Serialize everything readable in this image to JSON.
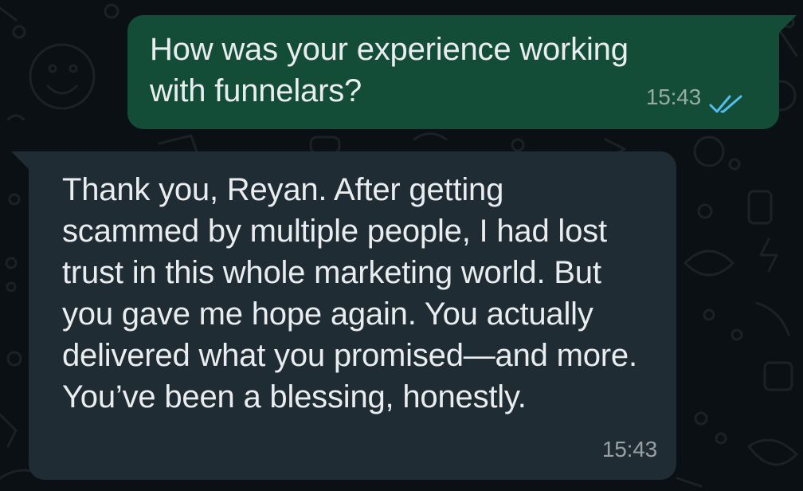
{
  "messages": [
    {
      "direction": "outgoing",
      "text": "How was your experience working with funnelars?",
      "time": "15:43",
      "status_icon": "double-check-read-icon"
    },
    {
      "direction": "incoming",
      "text": "Thank you, Reyan. After getting scammed by multiple people, I had lost trust in this whole marketing world. But you gave me hope again. You actually delivered what you promised—and more. You’ve been a blessing, honestly.",
      "time": "15:43"
    }
  ],
  "colors": {
    "background": "#0b1014",
    "outgoing_bubble": "#144d37",
    "incoming_bubble": "#202c33",
    "text": "#e9edef",
    "read_check": "#53bdeb"
  }
}
